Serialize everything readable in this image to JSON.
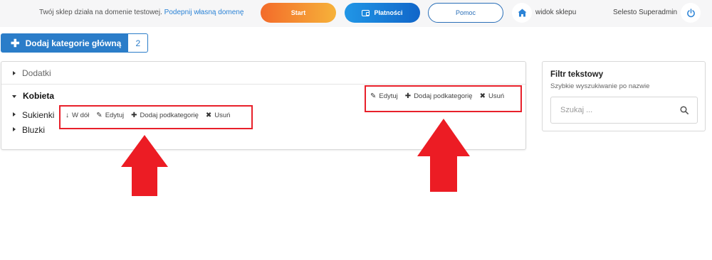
{
  "topbar": {
    "notice_text": "Twój sklep działa na domenie testowej.",
    "notice_link": "Podepnij własną domenę",
    "start_label": "Start",
    "payments_label": "Płatności",
    "help_label": "Pomoc",
    "shop_view_label": "widok sklepu",
    "admin_name": "Selesto Superadmin"
  },
  "add_main_category": {
    "label": "Dodaj kategorie główną",
    "count": "2"
  },
  "tree": {
    "categories": [
      {
        "label": "Dodatki"
      },
      {
        "label": "Kobieta",
        "actions": {
          "edit": "Edytuj",
          "add_sub": "Dodaj podkategorię",
          "delete": "Usuń"
        },
        "children": [
          {
            "label": "Sukienki",
            "actions": {
              "move_down": "W dół",
              "edit": "Edytuj",
              "add_sub": "Dodaj podkategorię",
              "delete": "Usuń"
            }
          },
          {
            "label": "Bluzki"
          }
        ]
      }
    ]
  },
  "filter": {
    "title": "Filtr tekstowy",
    "subtitle": "Szybkie wyszukiwanie po nazwie",
    "placeholder": "Szukaj ..."
  },
  "colors": {
    "accent_blue": "#2b7dc9",
    "highlight_red": "#e8202a",
    "start_gradient": [
      "#f36b2a",
      "#f6b23a"
    ],
    "payments_gradient": [
      "#2196e6",
      "#1166c9"
    ]
  },
  "icons": [
    "wallet-icon",
    "home-icon",
    "power-icon",
    "plus-icon",
    "caret-right-icon",
    "caret-down-icon",
    "arrow-down-icon",
    "pencil-icon",
    "times-icon",
    "search-icon",
    "up-arrow-annotation"
  ]
}
